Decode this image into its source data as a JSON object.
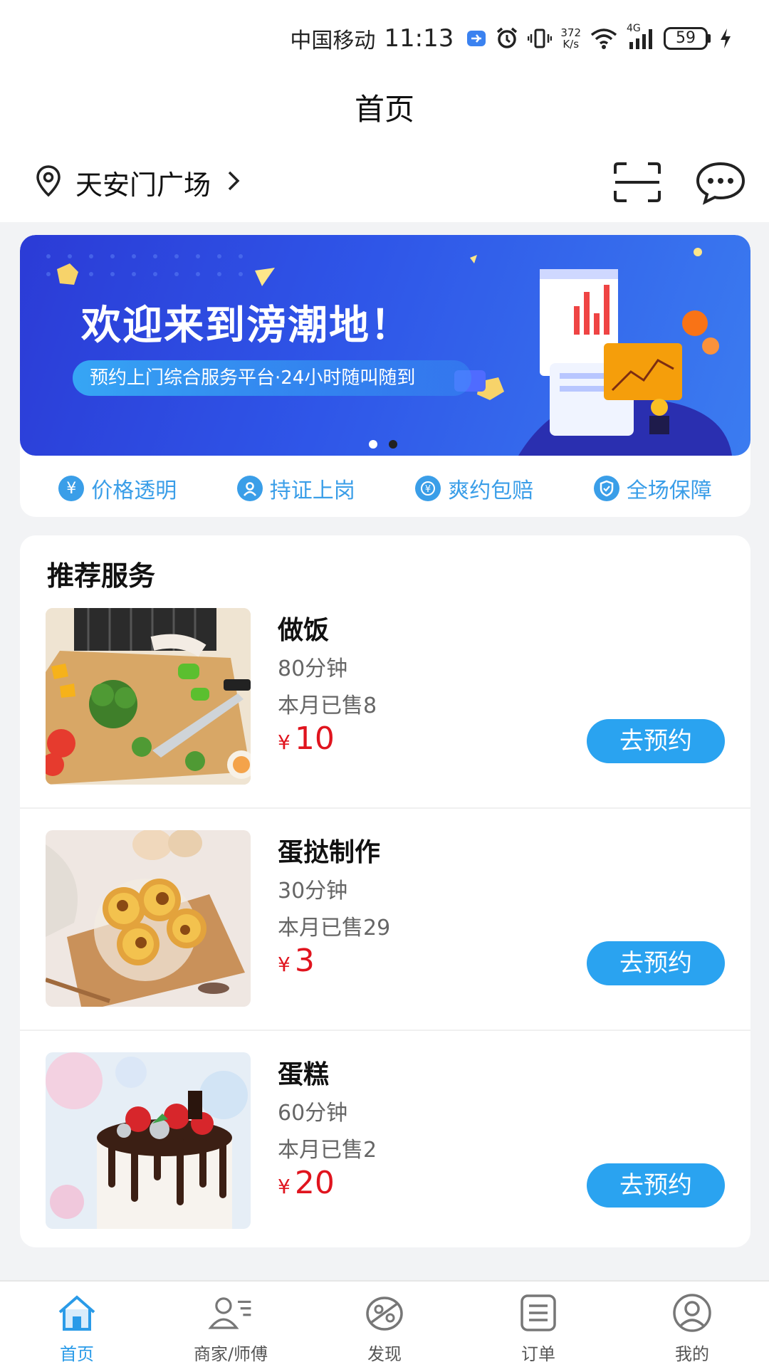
{
  "status_bar": {
    "carrier": "中国移动",
    "time": "11:13",
    "net_speed_value": "372",
    "net_speed_unit": "K/s",
    "network_type": "4G",
    "battery": "59"
  },
  "header": {
    "title": "首页",
    "location": "天安门广场"
  },
  "banner": {
    "title": "欢迎来到滂潮地！",
    "subtitle": "预约上门综合服务平台·24小时随叫随到",
    "page_count": 2,
    "active_page": 2
  },
  "features": [
    {
      "label": "价格透明",
      "icon": "yen-icon"
    },
    {
      "label": "持证上岗",
      "icon": "person-icon"
    },
    {
      "label": "爽约包赔",
      "icon": "compensation-icon"
    },
    {
      "label": "全场保障",
      "icon": "shield-icon"
    }
  ],
  "recommend": {
    "title": "推荐服务",
    "book_label": "去预约",
    "currency": "¥",
    "items": [
      {
        "name": "做饭",
        "duration": "80分钟",
        "sold": "本月已售8",
        "price": "10"
      },
      {
        "name": "蛋挞制作",
        "duration": "30分钟",
        "sold": "本月已售29",
        "price": "3"
      },
      {
        "name": "蛋糕",
        "duration": "60分钟",
        "sold": "本月已售2",
        "price": "20"
      }
    ]
  },
  "tabbar": {
    "items": [
      {
        "label": "首页",
        "active": true
      },
      {
        "label": "商家/师傅",
        "active": false
      },
      {
        "label": "发现",
        "active": false
      },
      {
        "label": "订单",
        "active": false
      },
      {
        "label": "我的",
        "active": false
      }
    ]
  },
  "colors": {
    "accent": "#2aa3f0",
    "price": "#e0141e",
    "feature": "#3a9ee8"
  }
}
